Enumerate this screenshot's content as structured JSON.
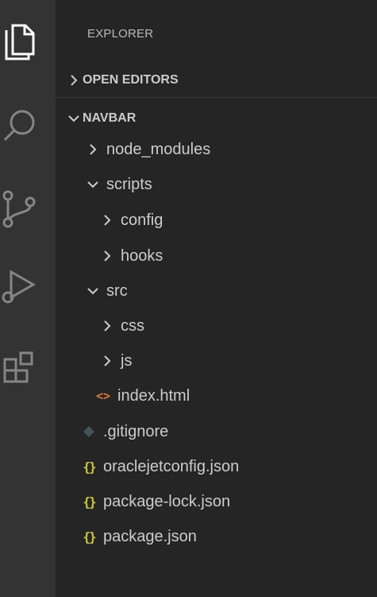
{
  "activity_bar": {
    "icons": [
      "files-icon",
      "search-icon",
      "source-control-icon",
      "run-debug-icon",
      "extensions-icon"
    ]
  },
  "sidebar": {
    "title": "EXPLORER",
    "open_editors": "OPEN EDITORS",
    "workspace": "NAVBAR",
    "tree": [
      {
        "label": "node_modules",
        "type": "folder",
        "expanded": false
      },
      {
        "label": "scripts",
        "type": "folder",
        "expanded": true
      },
      {
        "label": "config",
        "type": "folder",
        "expanded": false
      },
      {
        "label": "hooks",
        "type": "folder",
        "expanded": false
      },
      {
        "label": "src",
        "type": "folder",
        "expanded": true
      },
      {
        "label": "css",
        "type": "folder",
        "expanded": false
      },
      {
        "label": "js",
        "type": "folder",
        "expanded": false
      },
      {
        "label": "index.html",
        "type": "file",
        "icon": "html-file-icon"
      },
      {
        "label": ".gitignore",
        "type": "file",
        "icon": "git-file-icon"
      },
      {
        "label": "oraclejetconfig.json",
        "type": "file",
        "icon": "json-file-icon"
      },
      {
        "label": "package-lock.json",
        "type": "file",
        "icon": "json-file-icon"
      },
      {
        "label": "package.json",
        "type": "file",
        "icon": "json-file-icon"
      }
    ]
  },
  "colors": {
    "activity_bar": "#333333",
    "sidebar": "#252526",
    "text": "#cccccc",
    "json": "#cbcb41",
    "html": "#e37933"
  }
}
